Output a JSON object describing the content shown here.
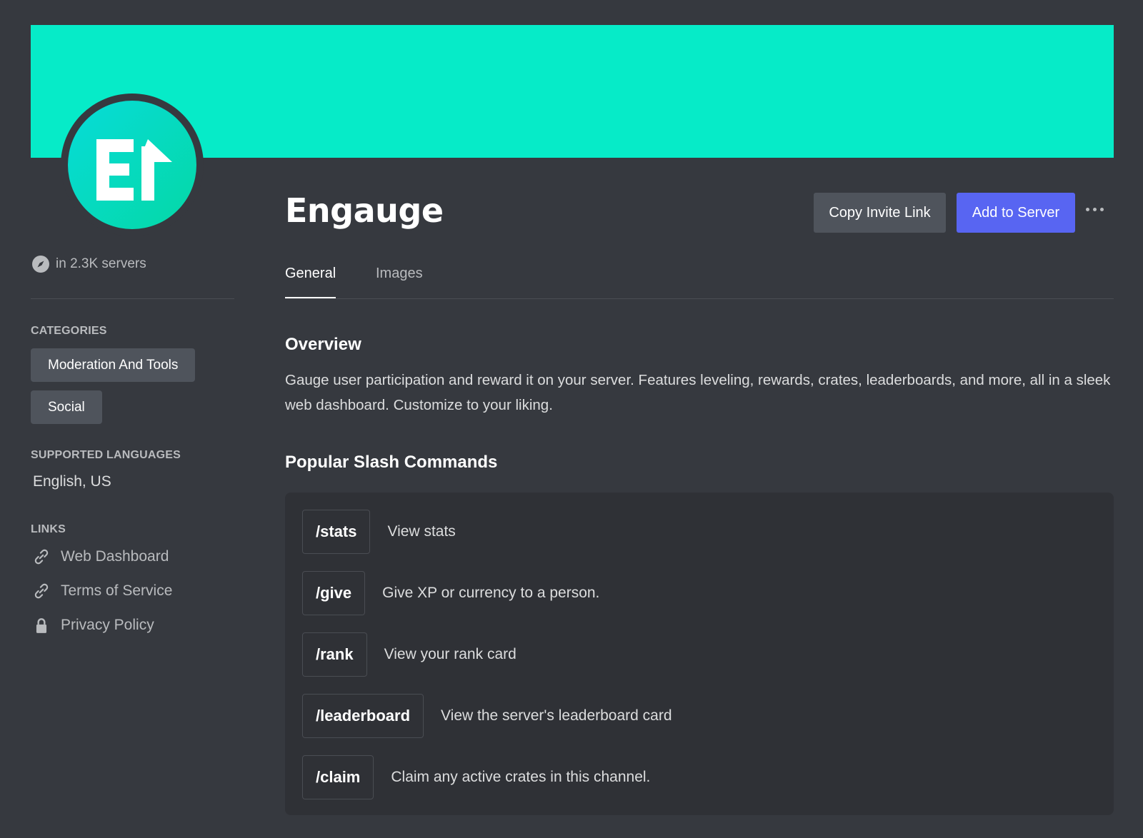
{
  "bot": {
    "name": "Engauge",
    "server_count": "in 2.3K servers",
    "avatar_letters": "E",
    "banner_color": "#06ebc8"
  },
  "actions": {
    "copy_invite": "Copy Invite Link",
    "add_to_server": "Add to Server",
    "more_icon": "more-dots-icon"
  },
  "tabs": [
    {
      "label": "General",
      "active": true
    },
    {
      "label": "Images",
      "active": false
    }
  ],
  "sidebar": {
    "categories_heading": "CATEGORIES",
    "categories": [
      "Moderation And Tools",
      "Social"
    ],
    "languages_heading": "SUPPORTED LANGUAGES",
    "languages": "English, US",
    "links_heading": "LINKS",
    "links": [
      {
        "label": "Web Dashboard",
        "icon": "link-icon"
      },
      {
        "label": "Terms of Service",
        "icon": "link-icon"
      },
      {
        "label": "Privacy Policy",
        "icon": "lock-icon"
      }
    ]
  },
  "overview": {
    "heading": "Overview",
    "text": "Gauge user participation and reward it on your server. Features leveling, rewards, crates, leaderboards, and more, all in a sleek web dashboard. Customize to your liking."
  },
  "commands": {
    "heading": "Popular Slash Commands",
    "items": [
      {
        "name": "/stats",
        "description": "View stats"
      },
      {
        "name": "/give",
        "description": "Give XP or currency to a person."
      },
      {
        "name": "/rank",
        "description": "View your rank card"
      },
      {
        "name": "/leaderboard",
        "description": "View the server's leaderboard card"
      },
      {
        "name": "/claim",
        "description": "Claim any active crates in this channel."
      }
    ]
  },
  "colors": {
    "background": "#36393f",
    "accent": "#5865f2",
    "secondary_button": "#4f545c",
    "panel": "#2f3136"
  }
}
